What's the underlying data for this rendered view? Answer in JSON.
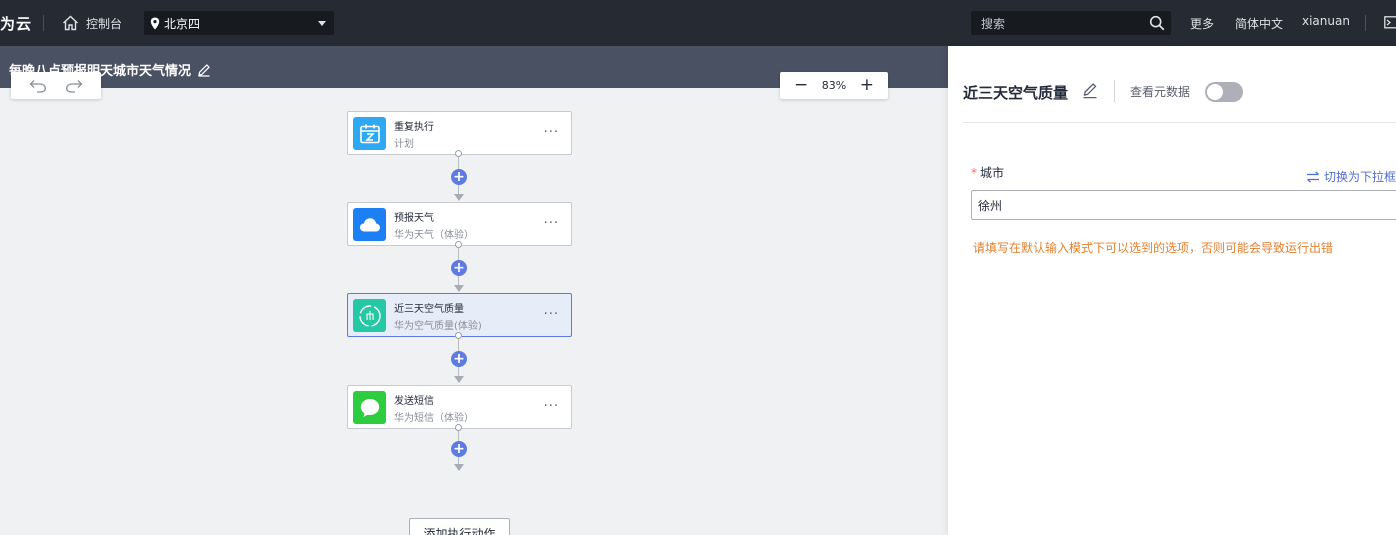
{
  "topbar": {
    "brand": "为云",
    "console_label": "控制台",
    "region": "北京四",
    "search_placeholder": "搜索",
    "more": "更多",
    "language": "简体中文",
    "username": "xianuan"
  },
  "canvas": {
    "flow_title": "每晚八点预报明天城市天气情况",
    "zoom": "83%",
    "add_action_label": "添加执行动作"
  },
  "nodes": [
    {
      "title": "重复执行",
      "subtitle": "计划",
      "icon": "calendar-icon",
      "color": "#2fa8f3"
    },
    {
      "title": "预报天气",
      "subtitle": "华为天气（体验）",
      "icon": "cloud-icon",
      "color": "#1c7ff4"
    },
    {
      "title": "近三天空气质量",
      "subtitle": "华为空气质量(体验)",
      "icon": "air-quality-icon",
      "color": "#25c8a4"
    },
    {
      "title": "发送短信",
      "subtitle": "华为短信（体验）",
      "icon": "message-icon",
      "color": "#2ecc3f"
    }
  ],
  "panel": {
    "title": "近三天空气质量",
    "meta_label": "查看元数据",
    "meta_toggle_on": false,
    "field_label": "城市",
    "switch_label": "切换为下拉框",
    "city_value": "徐州",
    "warning": "请填写在默认输入模式下可以选到的选项，否则可能会导致运行出错"
  }
}
